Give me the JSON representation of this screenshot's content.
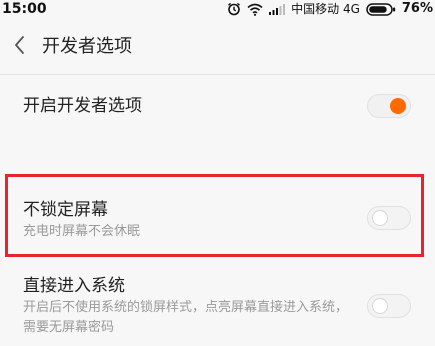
{
  "status_bar": {
    "time": "15:00",
    "icons": [
      "alarm-icon",
      "wifi-icon",
      "signal-icon",
      "battery-icon"
    ],
    "carrier": "中国移动 4G",
    "battery": "76%"
  },
  "header": {
    "back_icon": "chevron-left-icon",
    "title": "开发者选项"
  },
  "settings": [
    {
      "title": "开启开发者选项",
      "subtitle": "",
      "enabled": true
    },
    {
      "title": "不锁定屏幕",
      "subtitle": "充电时屏幕不会休眠",
      "enabled": false
    },
    {
      "title": "直接进入系统",
      "subtitle": "开启后不使用系统的锁屏样式，点亮屏幕直接进入系统，需要无屏幕密码",
      "enabled": false
    }
  ],
  "colors": {
    "accent": "#ff6a00",
    "highlight": "#e8232b",
    "background": "#f7f7f7",
    "subtitle_text": "#9a9a9a"
  }
}
